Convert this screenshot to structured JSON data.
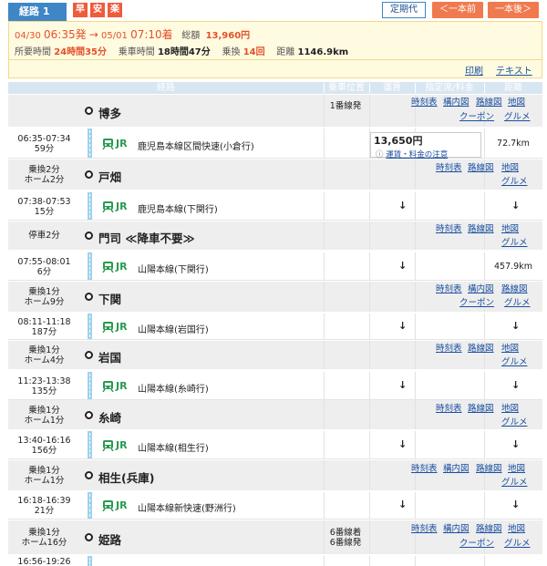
{
  "header": {
    "route_tab": "経路 1",
    "badges": [
      "早",
      "安",
      "楽"
    ],
    "commuter_pass": "定期代",
    "prev_button": "＜一本前",
    "next_button": "一本後＞"
  },
  "summary": {
    "dep_date": "04/30",
    "dep_time": "06:35発",
    "arrow": "→",
    "arr_date": "05/01",
    "arr_time": "07:10着",
    "total_label": "総額",
    "total_value": "13,960円",
    "duration_label": "所要時間",
    "duration_value": "24時間35分",
    "ride_label": "乗車時間",
    "ride_value": "18時間47分",
    "transfer_label": "乗換",
    "transfer_value": "14回",
    "distance_label": "距離",
    "distance_value": "1146.9km",
    "print_link": "印刷",
    "text_link": "テキスト"
  },
  "table_headers": [
    "経路",
    "乗車位置",
    "運賃",
    "指定席/料金",
    "距離"
  ],
  "links": {
    "timetable": "時刻表",
    "station_map": "構内図",
    "route_map": "路線図",
    "map": "地図",
    "coupon": "クーポン",
    "gourmet": "グルメ",
    "fare_note": "運賃・料金の注意",
    "arrow_down": "↓"
  },
  "stations": [
    {
      "left1": "",
      "left2": "",
      "name": "博多",
      "plat1": "1番線発",
      "plat2": ""
    },
    {
      "left1": "乗換2分",
      "left2": "ホーム2分",
      "name": "戸畑",
      "plat1": "",
      "plat2": ""
    },
    {
      "left1": "停車2分",
      "left2": "",
      "name": "門司 ≪降車不要≫",
      "plat1": "",
      "plat2": ""
    },
    {
      "left1": "乗換1分",
      "left2": "ホーム9分",
      "name": "下関",
      "plat1": "",
      "plat2": ""
    },
    {
      "left1": "乗換1分",
      "left2": "ホーム4分",
      "name": "岩国",
      "plat1": "",
      "plat2": ""
    },
    {
      "left1": "乗換1分",
      "left2": "ホーム1分",
      "name": "糸崎",
      "plat1": "",
      "plat2": ""
    },
    {
      "left1": "乗換1分",
      "left2": "ホーム1分",
      "name": "相生(兵庫)",
      "plat1": "",
      "plat2": ""
    },
    {
      "left1": "乗換1分",
      "left2": "ホーム16分",
      "name": "姫路",
      "plat1": "6番線着",
      "plat2": "6番線発"
    }
  ],
  "trains": [
    {
      "time": "06:35-07:34",
      "dur": "59分",
      "operator": "JR",
      "name": "鹿児島本線区間快速(小倉行)",
      "fare": "13,650円",
      "dist": "72.7km"
    },
    {
      "time": "07:38-07:53",
      "dur": "15分",
      "operator": "JR",
      "name": "鹿児島本線(下関行)",
      "fare": "",
      "dist": ""
    },
    {
      "time": "07:55-08:01",
      "dur": "6分",
      "operator": "JR",
      "name": "山陽本線(下関行)",
      "fare": "",
      "dist": "457.9km"
    },
    {
      "time": "08:11-11:18",
      "dur": "187分",
      "operator": "JR",
      "name": "山陽本線(岩国行)",
      "fare": "",
      "dist": ""
    },
    {
      "time": "11:23-13:38",
      "dur": "135分",
      "operator": "JR",
      "name": "山陽本線(糸崎行)",
      "fare": "",
      "dist": ""
    },
    {
      "time": "13:40-16:16",
      "dur": "156分",
      "operator": "JR",
      "name": "山陽本線(相生行)",
      "fare": "",
      "dist": ""
    },
    {
      "time": "16:18-16:39",
      "dur": "21分",
      "operator": "JR",
      "name": "山陽本線新快速(野洲行)",
      "fare": "",
      "dist": ""
    },
    {
      "time": "16:56-19:26",
      "dur": "",
      "operator": "",
      "name": "",
      "fare": "",
      "dist": ""
    }
  ]
}
